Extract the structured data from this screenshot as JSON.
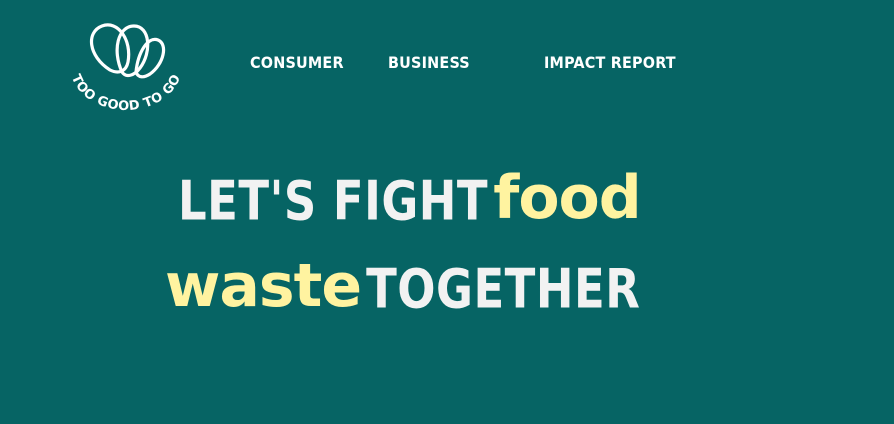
{
  "logo": {
    "text": "TOO GOOD TO GO",
    "color": "#ffffff"
  },
  "nav": {
    "items": [
      {
        "label": "CONSUMER"
      },
      {
        "label": "BUSINESS"
      },
      {
        "label": "IMPACT REPORT"
      }
    ]
  },
  "hero": {
    "line1_prefix": "LET'S FIGHT",
    "line1_accent": "food",
    "line2_accent": "waste",
    "line2_suffix": "TOGETHER"
  },
  "colors": {
    "background": "#066464",
    "heading": "#f2f2f2",
    "accent": "#fff3a0"
  }
}
